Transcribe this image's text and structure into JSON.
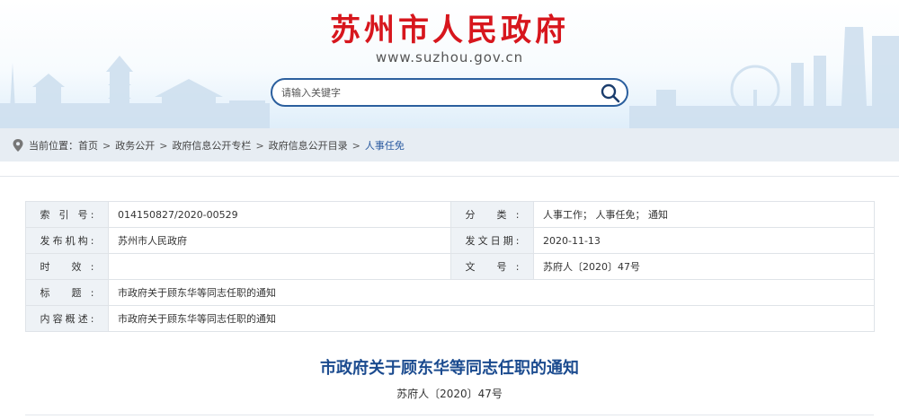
{
  "header": {
    "site_title": "苏州市人民政府",
    "site_url": "www.suzhou.gov.cn",
    "search_placeholder": "请输入关键字",
    "search_icon": "search-icon"
  },
  "breadcrumb": {
    "prefix": "当前位置：",
    "items": [
      "首页",
      "政务公开",
      "政府信息公开专栏",
      "政府信息公开目录",
      "人事任免"
    ],
    "separator": ">"
  },
  "meta": {
    "index_label": "索 引 号:",
    "index_value": "014150827/2020-00529",
    "category_label": "分 类:",
    "category_value": "人事工作；  人事任免；  通知",
    "publisher_label": "发布机构:",
    "publisher_value": "苏州市人民政府",
    "date_label": "发文日期:",
    "date_value": "2020-11-13",
    "validity_label": "时 效:",
    "validity_value": "",
    "docno_label": "文 号:",
    "docno_value": "苏府人〔2020〕47号",
    "title_label": "标 题:",
    "title_value": "市政府关于顾东华等同志任职的通知",
    "summary_label": "内容概述:",
    "summary_value": "市政府关于顾东华等同志任职的通知"
  },
  "document": {
    "title": "市政府关于顾东华等同志任职的通知",
    "number": "苏府人〔2020〕47号"
  },
  "colors": {
    "title_red": "#d7161d",
    "link_blue": "#2a5aa0",
    "doc_title_blue": "#1b4b8f",
    "label_bg": "#eef2f6",
    "crumb_bg": "#e7edf3"
  }
}
